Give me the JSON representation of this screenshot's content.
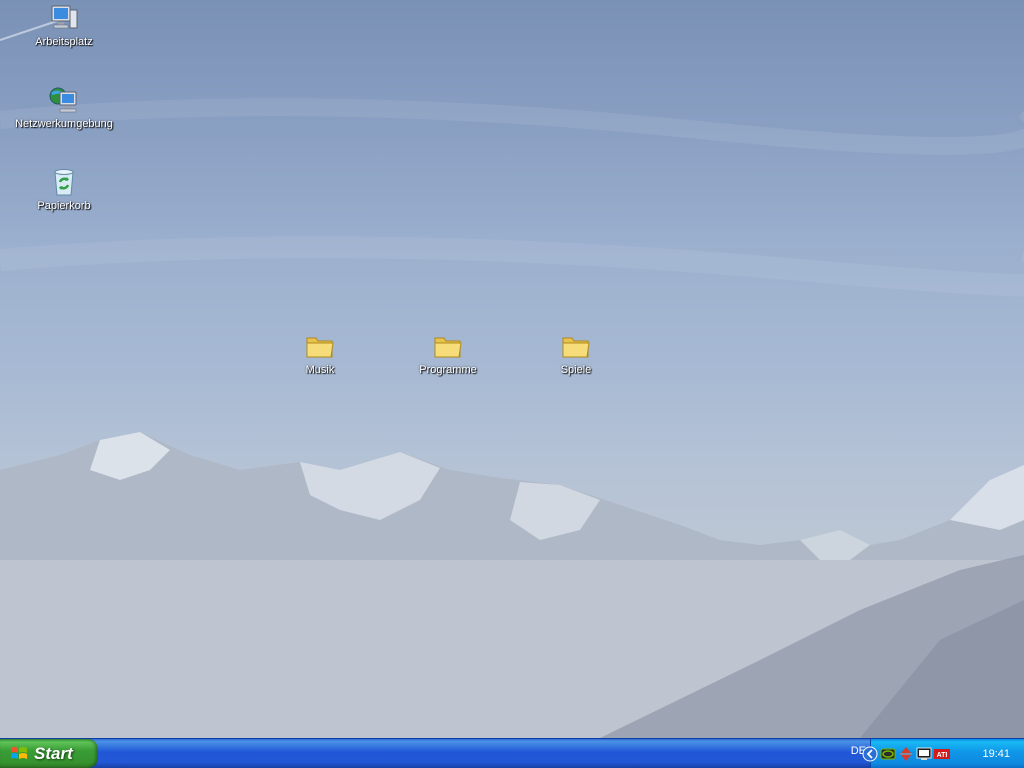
{
  "desktop": {
    "system_icons": [
      {
        "label": "Arbeitsplatz",
        "icon": "my-computer-icon"
      },
      {
        "label": "Netzwerkumgebung",
        "icon": "network-places-icon"
      },
      {
        "label": "Papierkorb",
        "icon": "recycle-bin-icon"
      }
    ],
    "folders": [
      {
        "label": "Musik",
        "icon": "folder-icon"
      },
      {
        "label": "Programme",
        "icon": "folder-icon"
      },
      {
        "label": "Spiele",
        "icon": "folder-icon"
      }
    ]
  },
  "taskbar": {
    "start_label": "Start",
    "language": "DE",
    "clock": "19:41",
    "tray_icons": [
      "expand-tray-icon",
      "nvidia-icon",
      "network-arrows-icon",
      "display-icon",
      "ati-icon"
    ]
  },
  "colors": {
    "taskbar_blue": "#2257d5",
    "start_green": "#3a9d36",
    "tray_blue": "#0f96e8"
  }
}
